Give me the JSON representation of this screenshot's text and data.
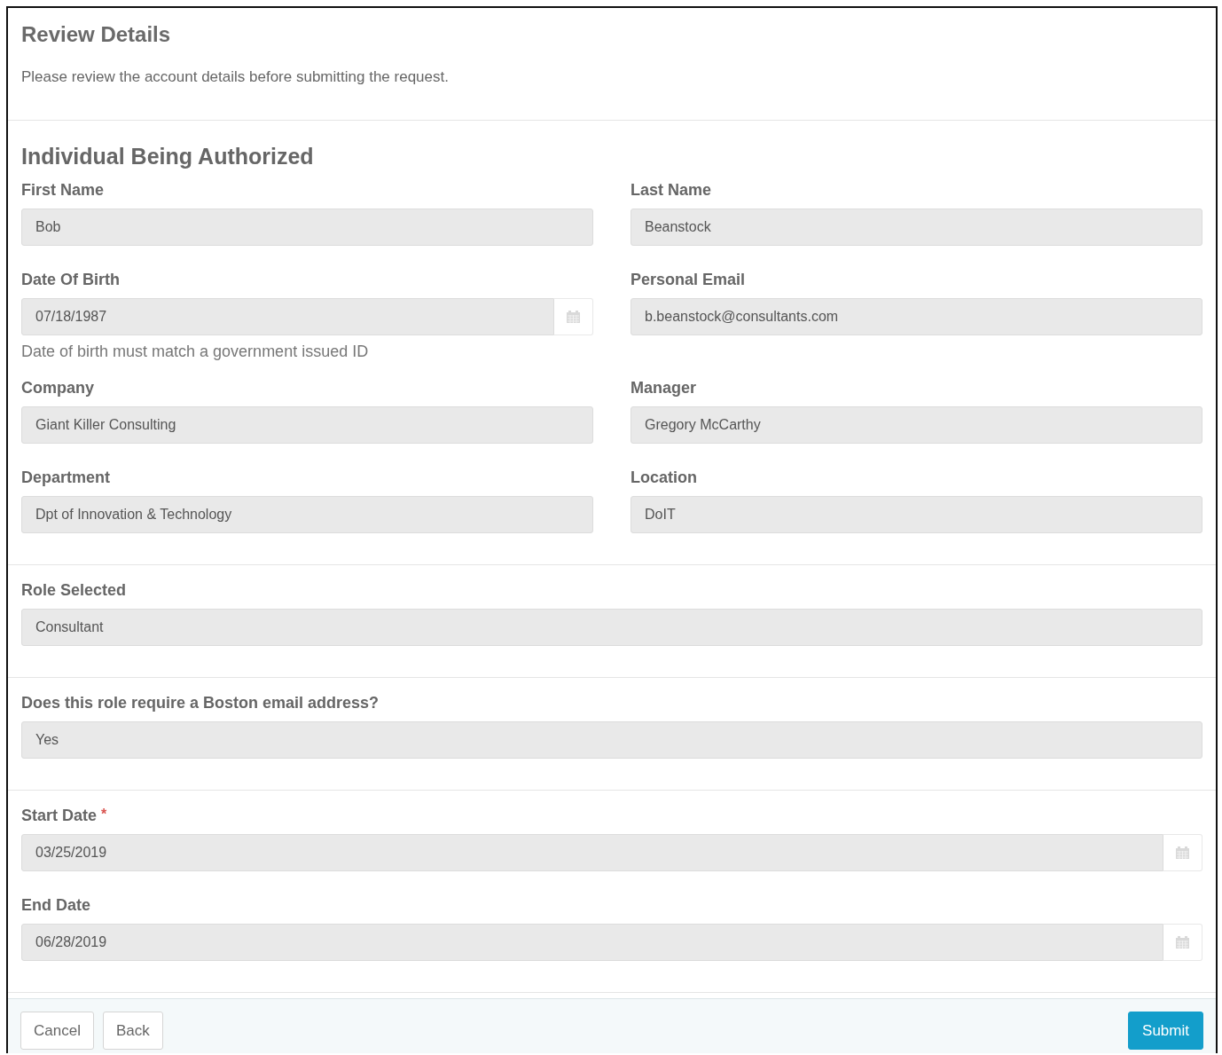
{
  "title": "Review Details",
  "intro": "Please review the account details before submitting the request.",
  "sections": [
    {
      "heading": "Individual Being Authorized",
      "kind": "two-column",
      "fields": [
        {
          "label": "First Name",
          "value": "Bob",
          "kind": "text"
        },
        {
          "label": "Last Name",
          "value": "Beanstock",
          "kind": "text"
        },
        {
          "label": "Date Of Birth",
          "value": "07/18/1987",
          "kind": "date",
          "help": "Date of birth must match a government issued ID"
        },
        {
          "label": "Personal Email",
          "value": "b.beanstock@consultants.com",
          "kind": "text"
        },
        {
          "label": "Company",
          "value": "Giant Killer Consulting",
          "kind": "text"
        },
        {
          "label": "Manager",
          "value": "Gregory McCarthy",
          "kind": "text"
        },
        {
          "label": "Department",
          "value": "Dpt of Innovation & Technology",
          "kind": "text"
        },
        {
          "label": "Location",
          "value": "DoIT",
          "kind": "text"
        }
      ]
    },
    {
      "kind": "single-column",
      "fields": [
        {
          "label": "Role Selected",
          "value": "Consultant",
          "kind": "text"
        }
      ]
    },
    {
      "kind": "single-column",
      "fields": [
        {
          "label": "Does this role require a Boston email address?",
          "value": "Yes",
          "kind": "text"
        }
      ]
    },
    {
      "kind": "single-column",
      "fields": [
        {
          "label": "Start Date",
          "required_mark": "*",
          "value": "03/25/2019",
          "kind": "date"
        },
        {
          "label": "End Date",
          "value": "06/28/2019",
          "kind": "date"
        }
      ]
    }
  ],
  "footer": {
    "left_buttons": [
      {
        "label": "Cancel",
        "kind": "default"
      },
      {
        "label": "Back",
        "kind": "default"
      }
    ],
    "right_buttons": [
      {
        "label": "Submit",
        "kind": "primary"
      }
    ]
  }
}
